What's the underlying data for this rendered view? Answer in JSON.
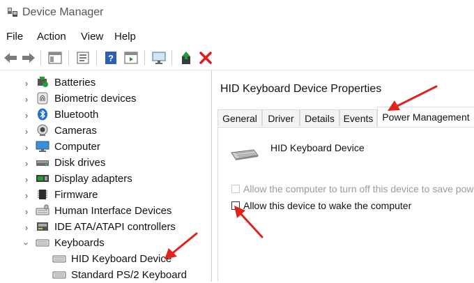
{
  "window": {
    "title": "Device Manager"
  },
  "menu": [
    "File",
    "Action",
    "View",
    "Help"
  ],
  "toolbar": {
    "icons": [
      "back-arrow-icon",
      "forward-arrow-icon",
      "show-hide-console-tree-icon",
      "properties-icon",
      "help-icon",
      "action-pane-icon",
      "monitor-icon",
      "update-driver-icon",
      "uninstall-device-icon"
    ]
  },
  "tree": {
    "items": [
      {
        "label": "Batteries",
        "icon": "battery-icon",
        "expanded": false
      },
      {
        "label": "Biometric devices",
        "icon": "fingerprint-icon",
        "expanded": false
      },
      {
        "label": "Bluetooth",
        "icon": "bluetooth-icon",
        "expanded": false
      },
      {
        "label": "Cameras",
        "icon": "camera-icon",
        "expanded": false
      },
      {
        "label": "Computer",
        "icon": "computer-icon",
        "expanded": false
      },
      {
        "label": "Disk drives",
        "icon": "disk-drive-icon",
        "expanded": false
      },
      {
        "label": "Display adapters",
        "icon": "display-adapter-icon",
        "expanded": false
      },
      {
        "label": "Firmware",
        "icon": "firmware-icon",
        "expanded": false
      },
      {
        "label": "Human Interface Devices",
        "icon": "hid-icon",
        "expanded": false
      },
      {
        "label": "IDE ATA/ATAPI controllers",
        "icon": "ide-controller-icon",
        "expanded": false
      },
      {
        "label": "Keyboards",
        "icon": "keyboard-icon",
        "expanded": true
      }
    ],
    "keyboards_children": [
      {
        "label": "HID Keyboard Device",
        "icon": "keyboard-icon"
      },
      {
        "label": "Standard PS/2 Keyboard",
        "icon": "keyboard-icon"
      }
    ]
  },
  "dialog": {
    "title": "HID Keyboard Device Properties",
    "tabs": [
      "General",
      "Driver",
      "Details",
      "Events",
      "Power Management"
    ],
    "active_tab": "Power Management",
    "device_name": "HID Keyboard Device",
    "options": [
      {
        "label": "Allow the computer to turn off this device to save power",
        "checked": false,
        "enabled": false
      },
      {
        "label": "Allow this device to wake the computer",
        "checked": false,
        "enabled": true
      }
    ]
  },
  "colors": {
    "annotation_arrow": "#e3211c",
    "help_blue": "#2a5fb5",
    "delete_red": "#e01b1b",
    "update_green": "#1f9e3a"
  }
}
